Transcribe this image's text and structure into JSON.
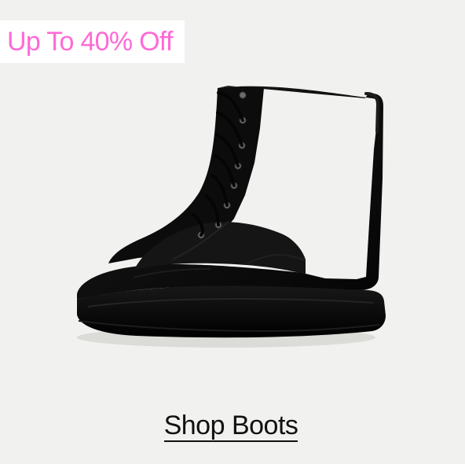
{
  "promo": {
    "badge_text": "Up To 40% Off",
    "badge_color": "#ff6ad5",
    "badge_background": "#ffffff"
  },
  "product": {
    "image_name": "black-lace-up-boot"
  },
  "cta": {
    "label": "Shop Boots",
    "text_color": "#111111"
  },
  "theme": {
    "background": "#f1f1ef"
  }
}
